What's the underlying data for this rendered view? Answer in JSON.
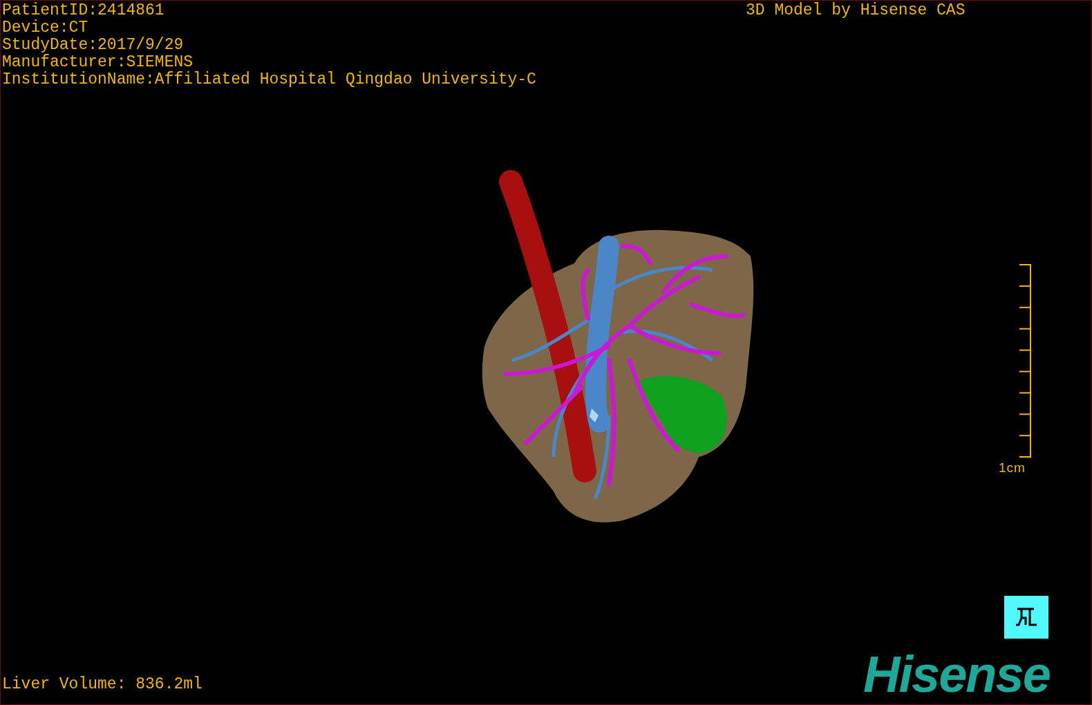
{
  "patient_info": [
    "PatientID:2414861",
    "Device:CT",
    "StudyDate:2017/9/29",
    "Manufacturer:SIEMENS",
    "InstitutionName:Affiliated Hospital Qingdao University-C"
  ],
  "header_right": "3D Model by Hisense CAS",
  "scale_bar": {
    "label": "1cm"
  },
  "liver_volume": "Liver Volume: 836.2ml",
  "logo": "Hisense"
}
